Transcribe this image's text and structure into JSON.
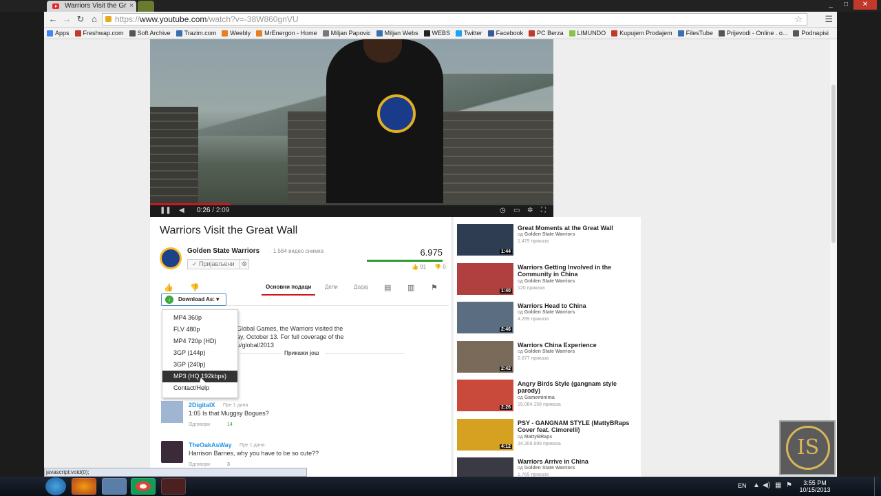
{
  "browser": {
    "tab_title": "Warriors Visit the Gr",
    "url_scheme": "https://",
    "url_host": "www.youtube.com",
    "url_path": "/watch?v=-38W860gnVU",
    "window_buttons": [
      "_",
      "□",
      "✕"
    ]
  },
  "bookmarks": [
    {
      "label": "Apps",
      "color": "#4285f4"
    },
    {
      "label": "Freshwap.com",
      "color": "#c0392b"
    },
    {
      "label": "Soft Archive",
      "color": "#555555"
    },
    {
      "label": "Trazim.com",
      "color": "#3a6fb0"
    },
    {
      "label": "Weebly",
      "color": "#e67e22"
    },
    {
      "label": "MrEnergon - Home",
      "color": "#e67e22"
    },
    {
      "label": "Miljan Papovic",
      "color": "#777777"
    },
    {
      "label": "Miljan Webs",
      "color": "#3a6fb0"
    },
    {
      "label": "WEBS",
      "color": "#222222"
    },
    {
      "label": "Twitter",
      "color": "#1da1f2"
    },
    {
      "label": "Facebook",
      "color": "#3b5998"
    },
    {
      "label": "PC Berza",
      "color": "#c0392b"
    },
    {
      "label": "LIMUNDO",
      "color": "#8bc34a"
    },
    {
      "label": "Kupujem Prodajem",
      "color": "#c0392b"
    },
    {
      "label": "FilesTube",
      "color": "#3a6fb0"
    },
    {
      "label": "Prijevodi - Online . o...",
      "color": "#555555"
    },
    {
      "label": "Podnapisi",
      "color": "#555555"
    }
  ],
  "player": {
    "current_time": "0:26",
    "duration": "2:09",
    "time_separator": "/",
    "progress_fraction": 0.2
  },
  "video": {
    "title": "Warriors Visit the Great Wall",
    "channel": "Golden State Warriors",
    "channel_video_count": "· 1.564 видео снимка",
    "subscribe_label": "✓ Пријављени",
    "views": "6.975",
    "likes": "91",
    "dislikes": "0",
    "like_fraction": 1.0
  },
  "tabs": {
    "about": "Основни подаци",
    "share": "Дели",
    "add": "Додај"
  },
  "download": {
    "button_label": "Download As: ▾",
    "options": [
      "MP4 360p",
      "FLV 480p",
      "MP4 720p (HD)",
      "3GP (144p)",
      "3GP (240p)",
      "MP3 (HQ 192kbps)",
      "Contact/Help"
    ],
    "selected_index": 5
  },
  "description": {
    "line1": "Global Games, the Warriors visited the",
    "line2": "ay, October 13. For full coverage of the",
    "line3": "u/global/2013",
    "show_more": "Прикажи још"
  },
  "comments": [
    {
      "user": "2DigitalX",
      "time": "Пре 1 дана",
      "text": "1:05 Is that Muggsy Bogues?",
      "reply": "Одговори",
      "likes": "14"
    },
    {
      "user": "TheOakAsWay",
      "time": "Пре 1 дана",
      "text": "Harrison Barnes, why you have to be so cute??",
      "reply": "Одговори",
      "likes": "3"
    }
  ],
  "related": [
    {
      "title": "Great Moments at the Great Wall",
      "channel": "Golden State Warriors",
      "views": "1.479 приказа",
      "duration": "1:44",
      "color": "#2f3d52"
    },
    {
      "title": "Warriors Getting Involved in the Community in China",
      "channel": "Golden State Warriors",
      "views": "120 приказа",
      "duration": "1:40",
      "color": "#b04040"
    },
    {
      "title": "Warriors Head to China",
      "channel": "Golden State Warriors",
      "views": "4.289 приказа",
      "duration": "2:46",
      "color": "#5b6d80"
    },
    {
      "title": "Warriors China Experience",
      "channel": "Golden State Warriors",
      "views": "2.677 приказа",
      "duration": "2:42",
      "color": "#7a6a5a"
    },
    {
      "title": "Angry Birds Style (gangnam style parody)",
      "channel": "Gameminima",
      "views": "15.064.158 приказа",
      "duration": "2:26",
      "color": "#c94a3a"
    },
    {
      "title": "PSY - GANGNAM STYLE (MattyBRaps Cover feat. Cimorelli)",
      "channel": "MattyBRaps",
      "views": "34.309.699 приказа",
      "duration": "4:12",
      "color": "#d6a020"
    },
    {
      "title": "Warriors Arrive in China",
      "channel": "Golden State Warriors",
      "views": "1.765 приказа",
      "duration": "",
      "color": "#3a3a44"
    }
  ],
  "related_channel_prefix": "од",
  "status": "javascript:void(0);",
  "watermark": "IS",
  "taskbar": {
    "lang": "EN",
    "time": "3:55 PM",
    "date": "10/15/2013"
  }
}
